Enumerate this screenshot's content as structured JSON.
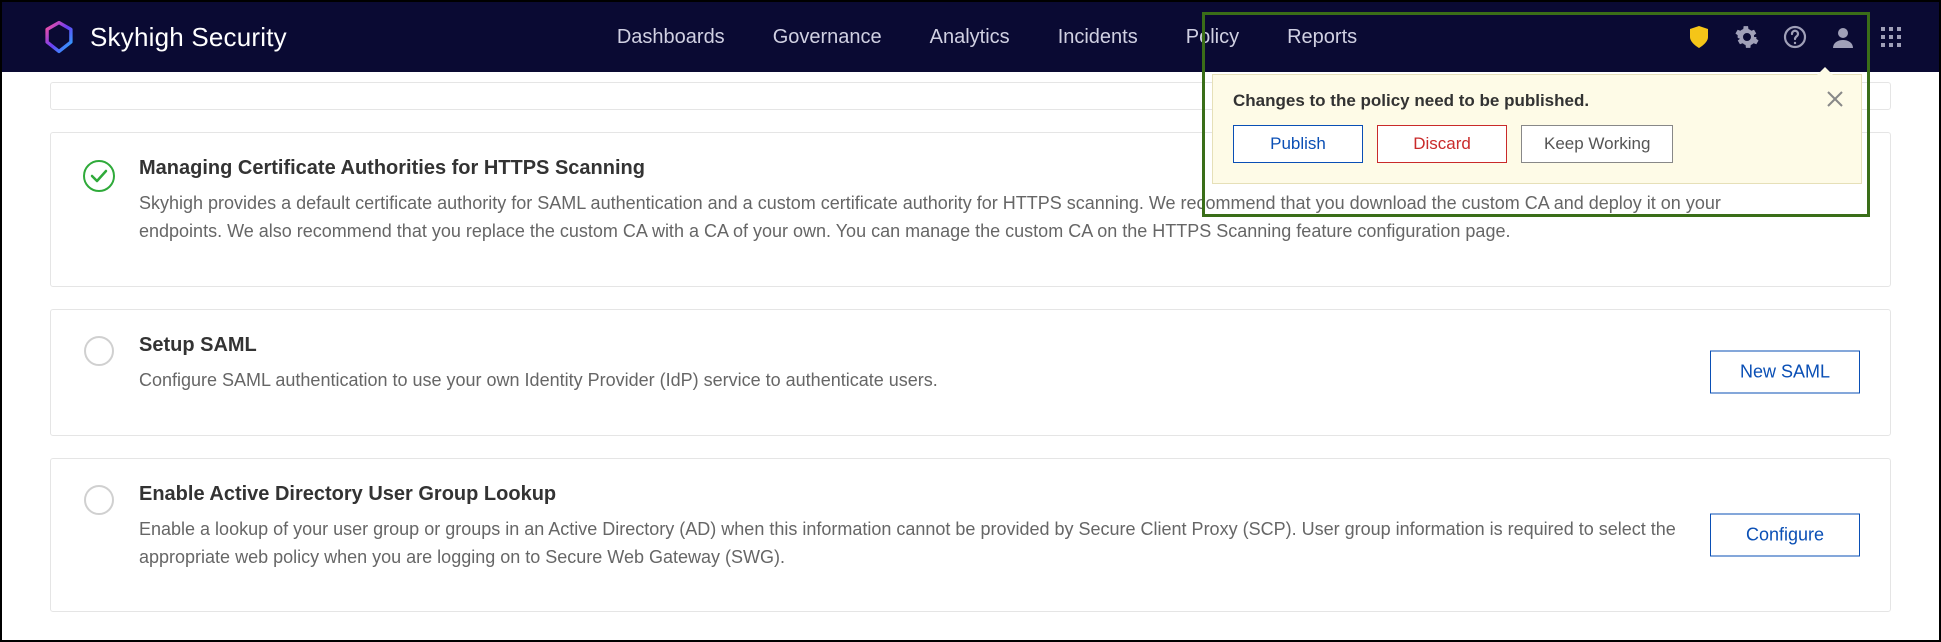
{
  "brand": {
    "name": "Skyhigh Security"
  },
  "nav": {
    "items": [
      "Dashboards",
      "Governance",
      "Analytics",
      "Incidents",
      "Policy",
      "Reports"
    ]
  },
  "notification": {
    "message": "Changes to the policy need to be published.",
    "publish_label": "Publish",
    "discard_label": "Discard",
    "keep_label": "Keep Working"
  },
  "cards": {
    "https_ca": {
      "title": "Managing Certificate Authorities for HTTPS Scanning",
      "description": "Skyhigh provides a default certificate authority for SAML authentication and a custom certificate authority for HTTPS scanning. We recommend that you download the custom CA and deploy it on your endpoints. We also recommend that you replace the custom CA with a CA of your own. You can manage the custom CA on the HTTPS Scanning feature configuration page.",
      "status": "complete"
    },
    "saml": {
      "title": "Setup SAML",
      "description": "Configure SAML authentication to use your own Identity Provider (IdP) service to authenticate users.",
      "action_label": "New SAML",
      "status": "pending"
    },
    "ad_lookup": {
      "title": "Enable Active Directory User Group Lookup",
      "description": "Enable a lookup of your user group or groups in an Active Directory (AD) when this information cannot be provided by Secure Client Proxy (SCP). User group information is required to select the appropriate web policy when you are logging on to Secure Web Gateway (SWG).",
      "action_label": "Configure",
      "status": "pending"
    }
  }
}
